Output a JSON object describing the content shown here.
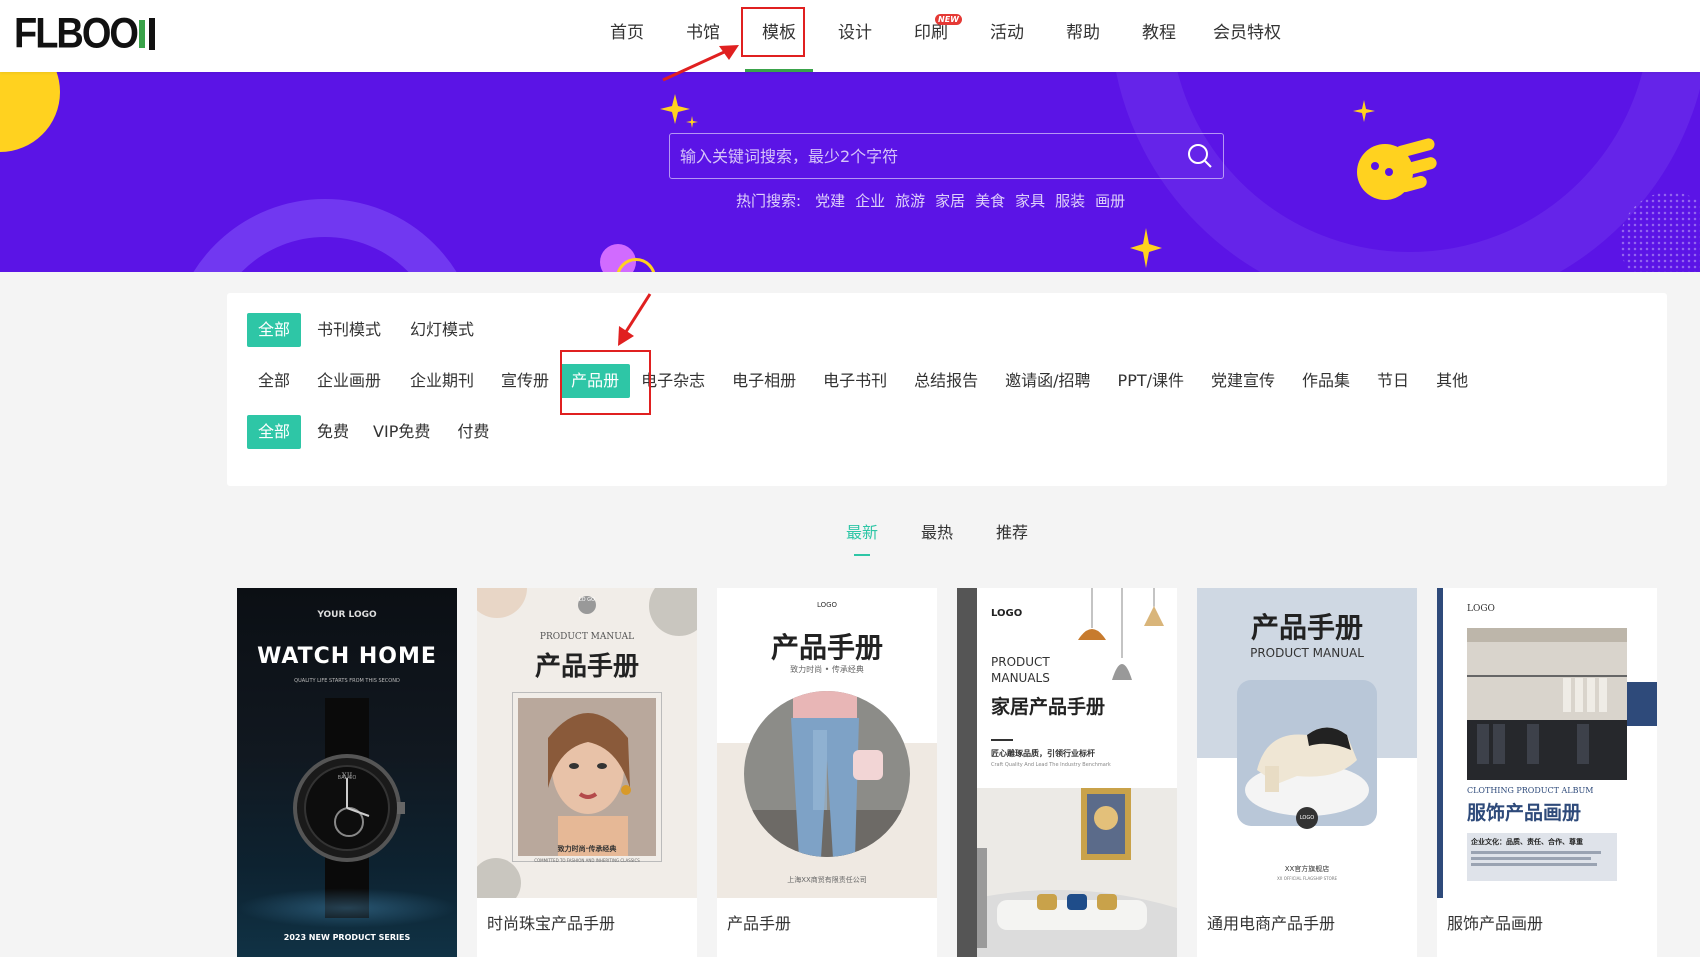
{
  "header": {
    "logo_text": "FLBOO",
    "nav": [
      {
        "label": "首页"
      },
      {
        "label": "书馆"
      },
      {
        "label": "模板"
      },
      {
        "label": "设计"
      },
      {
        "label": "印刷",
        "badge": "NEW"
      },
      {
        "label": "活动"
      },
      {
        "label": "帮助"
      },
      {
        "label": "教程"
      },
      {
        "label": "会员特权"
      }
    ],
    "active_index": 2
  },
  "banner": {
    "search_placeholder": "输入关键词搜索，最少2个字符",
    "hot_label": "热门搜索:",
    "hot_terms": [
      "党建",
      "企业",
      "旅游",
      "家居",
      "美食",
      "家具",
      "服装",
      "画册"
    ]
  },
  "filters": {
    "mode": [
      "全部",
      "书刊模式",
      "幻灯模式"
    ],
    "category": [
      "全部",
      "企业画册",
      "企业期刊",
      "宣传册",
      "产品册",
      "电子杂志",
      "电子相册",
      "电子书刊",
      "总结报告",
      "邀请函/招聘",
      "PPT/课件",
      "党建宣传",
      "作品集",
      "节日",
      "其他"
    ],
    "price": [
      "全部",
      "免费",
      "VIP免费",
      "付费"
    ],
    "selected": {
      "mode": "全部",
      "category": "产品册",
      "price": "全部"
    }
  },
  "sort": {
    "tabs": [
      "最新",
      "最热",
      "推荐"
    ],
    "active": "最新"
  },
  "templates": [
    {
      "title": "",
      "cover": {
        "logo": "YOUR LOGO",
        "heading": "WATCH HOME",
        "tagline": "QUALITY LIFE STARTS FROM THIS SECOND",
        "footer": "2023 NEW PRODUCT SERIES",
        "dial": "BAL CO"
      }
    },
    {
      "title": "时尚珠宝产品手册",
      "cover": {
        "logo": "LO GO",
        "sub": "PRODUCT MANUAL",
        "heading": "产品手册",
        "tagline": "致力时尚·传承经典",
        "footer": "COMMITTED TO FASHION AND INHERITING CLASSICS"
      }
    },
    {
      "title": "产品手册",
      "cover": {
        "logo": "LOGO",
        "heading": "产品手册",
        "tagline": "致力时尚 • 传承经典",
        "footer": "上海XX商贸有限责任公司"
      }
    },
    {
      "title": "",
      "cover": {
        "logo": "LOGO",
        "sub1": "PRODUCT",
        "sub2": "MANUALS",
        "heading": "家居产品手册",
        "tagline": "匠心雕琢品质，引领行业标杆",
        "tagline_en": "Craft Quality And Lead The Industry Benchmark"
      }
    },
    {
      "title": "通用电商产品手册",
      "cover": {
        "heading": "产品手册",
        "sub": "PRODUCT MANUAL",
        "logo": "LOGO",
        "footer": "XX官方旗舰店",
        "footer_en": "XX OFFICIAL FLAGSHIP STORE"
      }
    },
    {
      "title": "服饰产品画册",
      "cover": {
        "logo": "LOGO",
        "sub": "CLOTHING PRODUCT ALBUM",
        "heading": "服饰产品画册",
        "tagline": "企业文化：品质、责任、合作、尊重"
      }
    }
  ],
  "colors": {
    "accent": "#2ec6a6",
    "banner": "#5b14e6",
    "nav_underline": "#3aa34a",
    "annotation": "#e02020"
  }
}
